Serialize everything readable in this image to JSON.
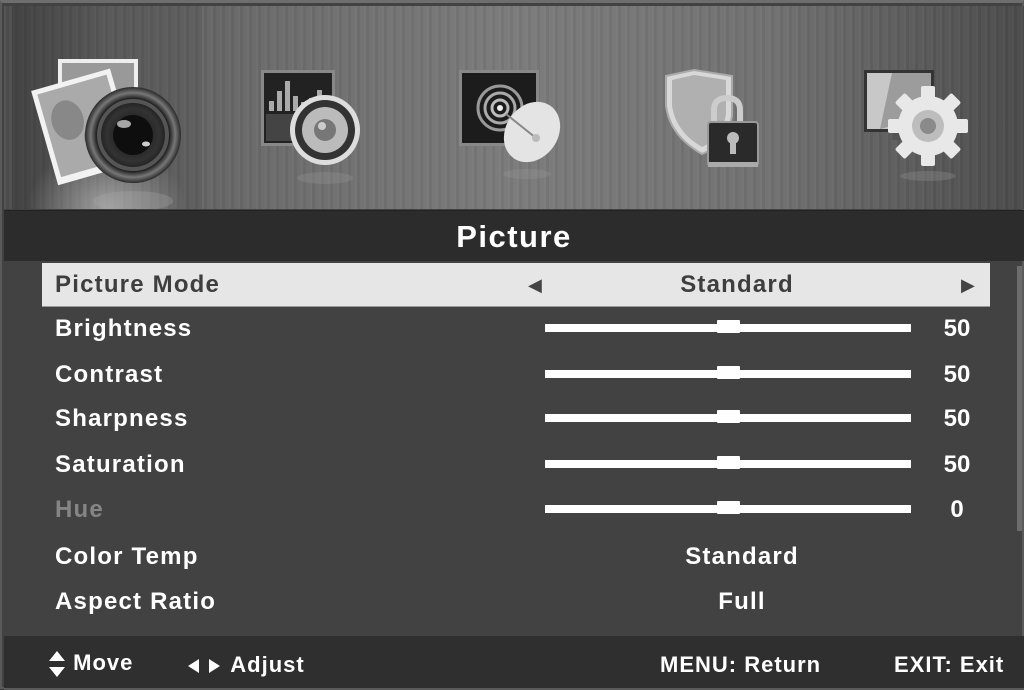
{
  "tabs": [
    {
      "name": "Picture",
      "icon": "photo-camera-icon",
      "active": true
    },
    {
      "name": "Sound",
      "icon": "speaker-equalizer-icon",
      "active": false
    },
    {
      "name": "Channel",
      "icon": "satellite-dish-icon",
      "active": false
    },
    {
      "name": "Lock",
      "icon": "shield-lock-icon",
      "active": false
    },
    {
      "name": "Setup",
      "icon": "monitor-gear-icon",
      "active": false
    }
  ],
  "title": "Picture",
  "menu": {
    "picture_mode": {
      "label": "Picture Mode",
      "value": "Standard",
      "left_arrow": "◀",
      "right_arrow": "▶"
    },
    "brightness": {
      "label": "Brightness",
      "value": "50",
      "level": 50,
      "max": 100
    },
    "contrast": {
      "label": "Contrast",
      "value": "50",
      "level": 50,
      "max": 100
    },
    "sharpness": {
      "label": "Sharpness",
      "value": "50",
      "level": 50,
      "max": 100
    },
    "saturation": {
      "label": "Saturation",
      "value": "50",
      "level": 50,
      "max": 100
    },
    "hue": {
      "label": "Hue",
      "value": "0",
      "level": 0,
      "min": -50,
      "max": 50,
      "disabled": true
    },
    "color_temp": {
      "label": "Color Temp",
      "value": "Standard"
    },
    "aspect_ratio": {
      "label": "Aspect Ratio",
      "value": "Full"
    }
  },
  "footer": {
    "move": "Move",
    "adjust": "Adjust",
    "menu": "MENU: Return",
    "exit": "EXIT: Exit"
  },
  "colors": {
    "background": "#424242",
    "title_bar": "#2c2c2c",
    "selected_row": "#e6e6e6",
    "text": "#ffffff",
    "disabled_text": "#858585"
  }
}
